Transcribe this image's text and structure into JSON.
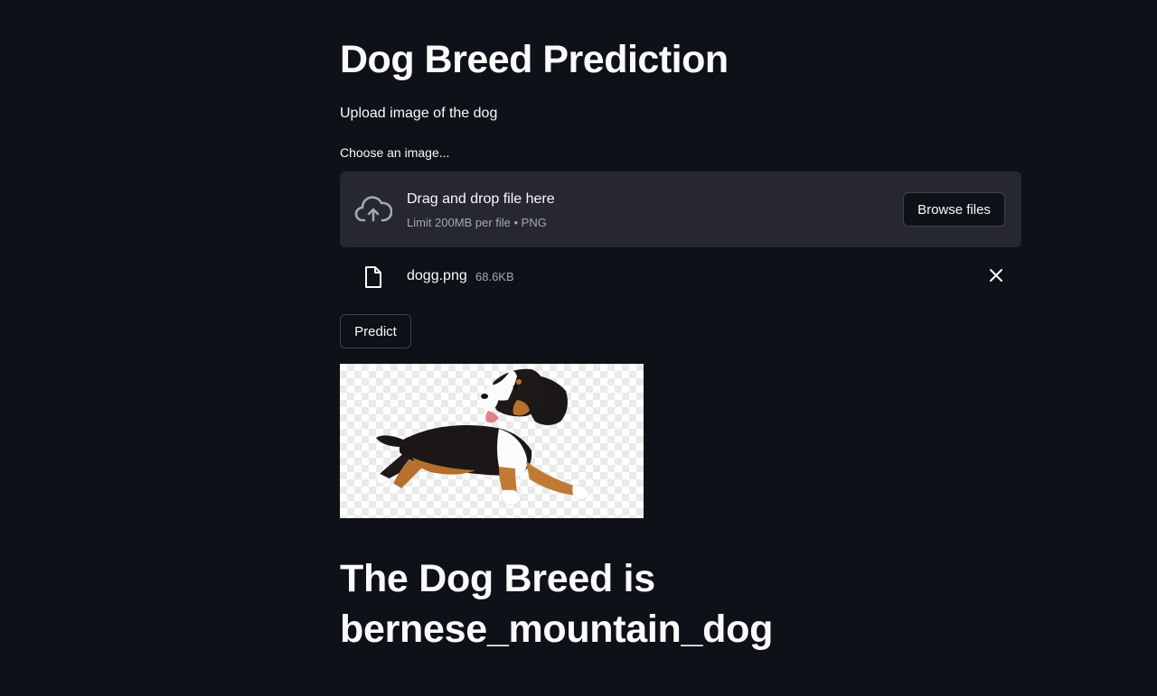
{
  "app": {
    "title": "Dog Breed Prediction",
    "subtitle": "Upload image of the dog"
  },
  "uploader": {
    "label": "Choose an image...",
    "drag_text": "Drag and drop file here",
    "limit_text": "Limit 200MB per file • PNG",
    "browse_label": "Browse files",
    "upload_icon": "cloud-upload-icon"
  },
  "uploaded_file": {
    "name": "dogg.png",
    "size": "68.6KB",
    "file_icon": "file-icon",
    "remove_icon": "close-icon"
  },
  "actions": {
    "predict_label": "Predict"
  },
  "result": {
    "text": "The Dog Breed is bernese_mountain_dog"
  },
  "colors": {
    "background": "#0e1117",
    "dropzone": "#262730",
    "text": "#fafafa",
    "muted": "#a3a8b4"
  }
}
